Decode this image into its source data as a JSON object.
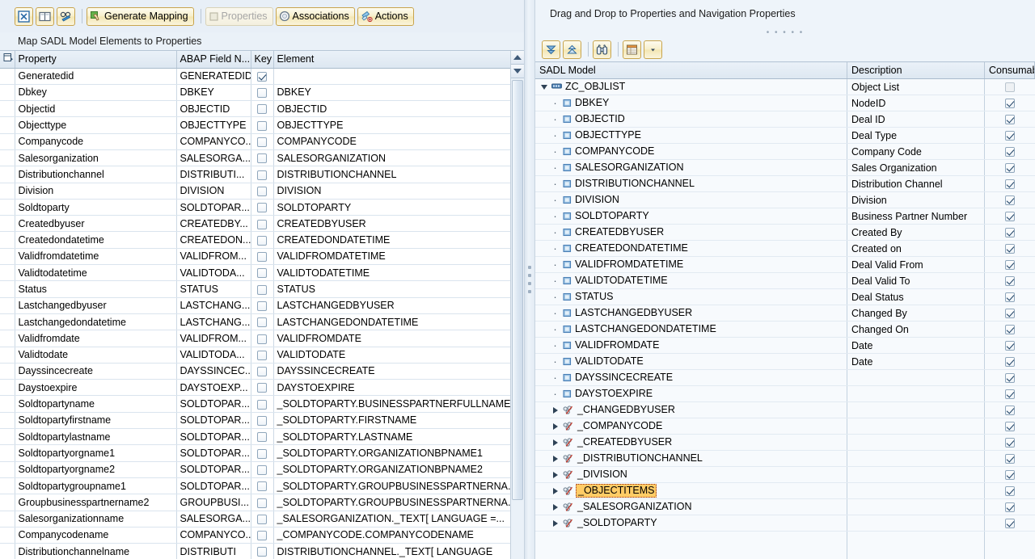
{
  "left_panel": {
    "toolbar": {
      "icon_buttons": [
        {
          "name": "close-icon",
          "glyph": "x-box"
        },
        {
          "name": "layout-columns-icon",
          "glyph": "columns"
        },
        {
          "name": "display-change-icon",
          "glyph": "glasses-pencil"
        }
      ],
      "generate_mapping_label": "Generate Mapping",
      "properties_label": "Properties",
      "properties_disabled": true,
      "associations_label": "Associations",
      "actions_label": "Actions"
    },
    "subtitle": "Map SADL Model Elements to Properties",
    "columns": [
      "Property",
      "ABAP Field N...",
      "Key",
      "Element"
    ],
    "rows": [
      {
        "property": "Generatedid",
        "abap": "GENERATEDID",
        "key": true,
        "element": ""
      },
      {
        "property": "Dbkey",
        "abap": "DBKEY",
        "key": false,
        "element": "DBKEY"
      },
      {
        "property": "Objectid",
        "abap": "OBJECTID",
        "key": false,
        "element": "OBJECTID"
      },
      {
        "property": "Objecttype",
        "abap": "OBJECTTYPE",
        "key": false,
        "element": "OBJECTTYPE"
      },
      {
        "property": "Companycode",
        "abap": "COMPANYCO...",
        "key": false,
        "element": "COMPANYCODE"
      },
      {
        "property": "Salesorganization",
        "abap": "SALESORGA...",
        "key": false,
        "element": "SALESORGANIZATION"
      },
      {
        "property": "Distributionchannel",
        "abap": "DISTRIBUTI...",
        "key": false,
        "element": "DISTRIBUTIONCHANNEL"
      },
      {
        "property": "Division",
        "abap": "DIVISION",
        "key": false,
        "element": "DIVISION"
      },
      {
        "property": "Soldtoparty",
        "abap": "SOLDTOPAR...",
        "key": false,
        "element": "SOLDTOPARTY"
      },
      {
        "property": "Createdbyuser",
        "abap": "CREATEDBY...",
        "key": false,
        "element": "CREATEDBYUSER"
      },
      {
        "property": "Createdondatetime",
        "abap": "CREATEDON...",
        "key": false,
        "element": "CREATEDONDATETIME"
      },
      {
        "property": "Validfromdatetime",
        "abap": "VALIDFROM...",
        "key": false,
        "element": "VALIDFROMDATETIME"
      },
      {
        "property": "Validtodatetime",
        "abap": "VALIDTODA...",
        "key": false,
        "element": "VALIDTODATETIME"
      },
      {
        "property": "Status",
        "abap": "STATUS",
        "key": false,
        "element": "STATUS"
      },
      {
        "property": "Lastchangedbyuser",
        "abap": "LASTCHANG...",
        "key": false,
        "element": "LASTCHANGEDBYUSER"
      },
      {
        "property": "Lastchangedondatetime",
        "abap": "LASTCHANG...",
        "key": false,
        "element": "LASTCHANGEDONDATETIME"
      },
      {
        "property": "Validfromdate",
        "abap": "VALIDFROM...",
        "key": false,
        "element": "VALIDFROMDATE"
      },
      {
        "property": "Validtodate",
        "abap": "VALIDTODA...",
        "key": false,
        "element": "VALIDTODATE"
      },
      {
        "property": "Dayssincecreate",
        "abap": "DAYSSINCEC...",
        "key": false,
        "element": "DAYSSINCECREATE"
      },
      {
        "property": "Daystoexpire",
        "abap": "DAYSTOEXP...",
        "key": false,
        "element": "DAYSTOEXPIRE"
      },
      {
        "property": "Soldtopartyname",
        "abap": "SOLDTOPAR...",
        "key": false,
        "element": "_SOLDTOPARTY.BUSINESSPARTNERFULLNAME"
      },
      {
        "property": "Soldtopartyfirstname",
        "abap": "SOLDTOPAR...",
        "key": false,
        "element": "_SOLDTOPARTY.FIRSTNAME"
      },
      {
        "property": "Soldtopartylastname",
        "abap": "SOLDTOPAR...",
        "key": false,
        "element": "_SOLDTOPARTY.LASTNAME"
      },
      {
        "property": "Soldtopartyorgname1",
        "abap": "SOLDTOPAR...",
        "key": false,
        "element": "_SOLDTOPARTY.ORGANIZATIONBPNAME1"
      },
      {
        "property": "Soldtopartyorgname2",
        "abap": "SOLDTOPAR...",
        "key": false,
        "element": "_SOLDTOPARTY.ORGANIZATIONBPNAME2"
      },
      {
        "property": "Soldtopartygroupname1",
        "abap": "SOLDTOPAR...",
        "key": false,
        "element": "_SOLDTOPARTY.GROUPBUSINESSPARTNERNA..."
      },
      {
        "property": "Groupbusinesspartnername2",
        "abap": "GROUPBUSI...",
        "key": false,
        "element": "_SOLDTOPARTY.GROUPBUSINESSPARTNERNA..."
      },
      {
        "property": "Salesorganizationname",
        "abap": "SALESORGA...",
        "key": false,
        "element": "_SALESORGANIZATION._TEXT[ LANGUAGE =..."
      },
      {
        "property": "Companycodename",
        "abap": "COMPANYCO...",
        "key": false,
        "element": "_COMPANYCODE.COMPANYCODENAME"
      },
      {
        "property": "Distributionchannelname",
        "abap": "DISTRIBUTI",
        "key": false,
        "element": "DISTRIBUTIONCHANNEL._TEXT[ LANGUAGE"
      }
    ]
  },
  "right_panel": {
    "title": "Drag and Drop to Properties and Navigation Properties",
    "toolbar": {
      "icon_buttons": [
        {
          "name": "expand-all-icon",
          "glyph": "double-chevron-down"
        },
        {
          "name": "collapse-all-icon",
          "glyph": "double-chevron-up"
        },
        {
          "name": "find-icon",
          "glyph": "binoculars"
        },
        {
          "name": "layout-settings-icon",
          "glyph": "table-grid"
        },
        {
          "name": "layout-dropdown-icon",
          "glyph": "caret-down"
        }
      ]
    },
    "columns": [
      "SADL Model",
      "Description",
      "Consumabl"
    ],
    "tree": [
      {
        "label": "ZC_OBJLIST",
        "desc": "Object List",
        "level": 0,
        "kind": "entity",
        "expanded": true,
        "consumable": false,
        "selected": false
      },
      {
        "label": "DBKEY",
        "desc": "NodeID",
        "level": 1,
        "kind": "field",
        "consumable": true,
        "selected": false
      },
      {
        "label": "OBJECTID",
        "desc": "Deal ID",
        "level": 1,
        "kind": "field",
        "consumable": true,
        "selected": false
      },
      {
        "label": "OBJECTTYPE",
        "desc": "Deal Type",
        "level": 1,
        "kind": "field",
        "consumable": true,
        "selected": false
      },
      {
        "label": "COMPANYCODE",
        "desc": "Company Code",
        "level": 1,
        "kind": "field",
        "consumable": true,
        "selected": false
      },
      {
        "label": "SALESORGANIZATION",
        "desc": "Sales Organization",
        "level": 1,
        "kind": "field",
        "consumable": true,
        "selected": false
      },
      {
        "label": "DISTRIBUTIONCHANNEL",
        "desc": "Distribution Channel",
        "level": 1,
        "kind": "field",
        "consumable": true,
        "selected": false
      },
      {
        "label": "DIVISION",
        "desc": "Division",
        "level": 1,
        "kind": "field",
        "consumable": true,
        "selected": false
      },
      {
        "label": "SOLDTOPARTY",
        "desc": "Business Partner Number",
        "level": 1,
        "kind": "field",
        "consumable": true,
        "selected": false
      },
      {
        "label": "CREATEDBYUSER",
        "desc": "Created By",
        "level": 1,
        "kind": "field",
        "consumable": true,
        "selected": false
      },
      {
        "label": "CREATEDONDATETIME",
        "desc": "Created on",
        "level": 1,
        "kind": "field",
        "consumable": true,
        "selected": false
      },
      {
        "label": "VALIDFROMDATETIME",
        "desc": "Deal Valid From",
        "level": 1,
        "kind": "field",
        "consumable": true,
        "selected": false
      },
      {
        "label": "VALIDTODATETIME",
        "desc": "Deal Valid To",
        "level": 1,
        "kind": "field",
        "consumable": true,
        "selected": false
      },
      {
        "label": "STATUS",
        "desc": "Deal Status",
        "level": 1,
        "kind": "field",
        "consumable": true,
        "selected": false
      },
      {
        "label": "LASTCHANGEDBYUSER",
        "desc": "Changed By",
        "level": 1,
        "kind": "field",
        "consumable": true,
        "selected": false
      },
      {
        "label": "LASTCHANGEDONDATETIME",
        "desc": "Changed On",
        "level": 1,
        "kind": "field",
        "consumable": true,
        "selected": false
      },
      {
        "label": "VALIDFROMDATE",
        "desc": "Date",
        "level": 1,
        "kind": "field",
        "consumable": true,
        "selected": false
      },
      {
        "label": "VALIDTODATE",
        "desc": "Date",
        "level": 1,
        "kind": "field",
        "consumable": true,
        "selected": false
      },
      {
        "label": "DAYSSINCECREATE",
        "desc": "",
        "level": 1,
        "kind": "field",
        "consumable": true,
        "selected": false
      },
      {
        "label": "DAYSTOEXPIRE",
        "desc": "",
        "level": 1,
        "kind": "field",
        "consumable": true,
        "selected": false
      },
      {
        "label": "_CHANGEDBYUSER",
        "desc": "",
        "level": 1,
        "kind": "association",
        "expanded": false,
        "consumable": true,
        "selected": false
      },
      {
        "label": "_COMPANYCODE",
        "desc": "",
        "level": 1,
        "kind": "association",
        "expanded": false,
        "consumable": true,
        "selected": false
      },
      {
        "label": "_CREATEDBYUSER",
        "desc": "",
        "level": 1,
        "kind": "association",
        "expanded": false,
        "consumable": true,
        "selected": false
      },
      {
        "label": "_DISTRIBUTIONCHANNEL",
        "desc": "",
        "level": 1,
        "kind": "association",
        "expanded": false,
        "consumable": true,
        "selected": false
      },
      {
        "label": "_DIVISION",
        "desc": "",
        "level": 1,
        "kind": "association",
        "expanded": false,
        "consumable": true,
        "selected": false
      },
      {
        "label": "_OBJECTITEMS",
        "desc": "",
        "level": 1,
        "kind": "association",
        "expanded": false,
        "consumable": true,
        "selected": true
      },
      {
        "label": "_SALESORGANIZATION",
        "desc": "",
        "level": 1,
        "kind": "association",
        "expanded": false,
        "consumable": true,
        "selected": false
      },
      {
        "label": "_SOLDTOPARTY",
        "desc": "",
        "level": 1,
        "kind": "association",
        "expanded": false,
        "consumable": true,
        "selected": false
      }
    ]
  },
  "colors": {
    "selection_highlight": "#ffcc66",
    "selection_border": "#9a2b13",
    "button_border": "#c8a44d",
    "panel_bg": "#eaf1f8",
    "header_bg": "#dde7f1"
  }
}
